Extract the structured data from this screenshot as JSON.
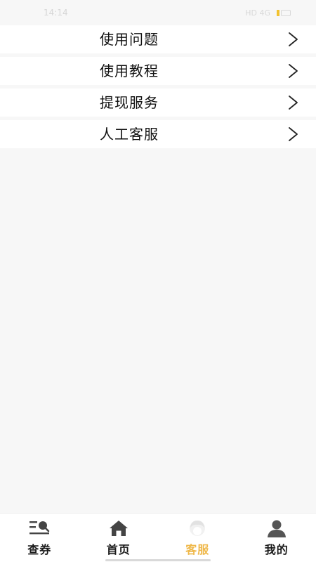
{
  "status_bar": {
    "time": "14:14",
    "indicators": "HD 4G",
    "battery_text": "▪▪"
  },
  "menu": {
    "items": [
      {
        "label": "使用问题",
        "icon": "chevron-right-icon"
      },
      {
        "label": "使用教程",
        "icon": "chevron-right-icon"
      },
      {
        "label": "提现服务",
        "icon": "chevron-right-icon"
      },
      {
        "label": "人工客服",
        "icon": "chevron-right-icon"
      }
    ]
  },
  "bottom_nav": {
    "active_index": 2,
    "accent_color": "#efb84a",
    "items": [
      {
        "label": "查券",
        "icon": "search-list-icon"
      },
      {
        "label": "首页",
        "icon": "home-icon"
      },
      {
        "label": "客服",
        "icon": "customer-service-icon"
      },
      {
        "label": "我的",
        "icon": "user-icon"
      }
    ]
  }
}
